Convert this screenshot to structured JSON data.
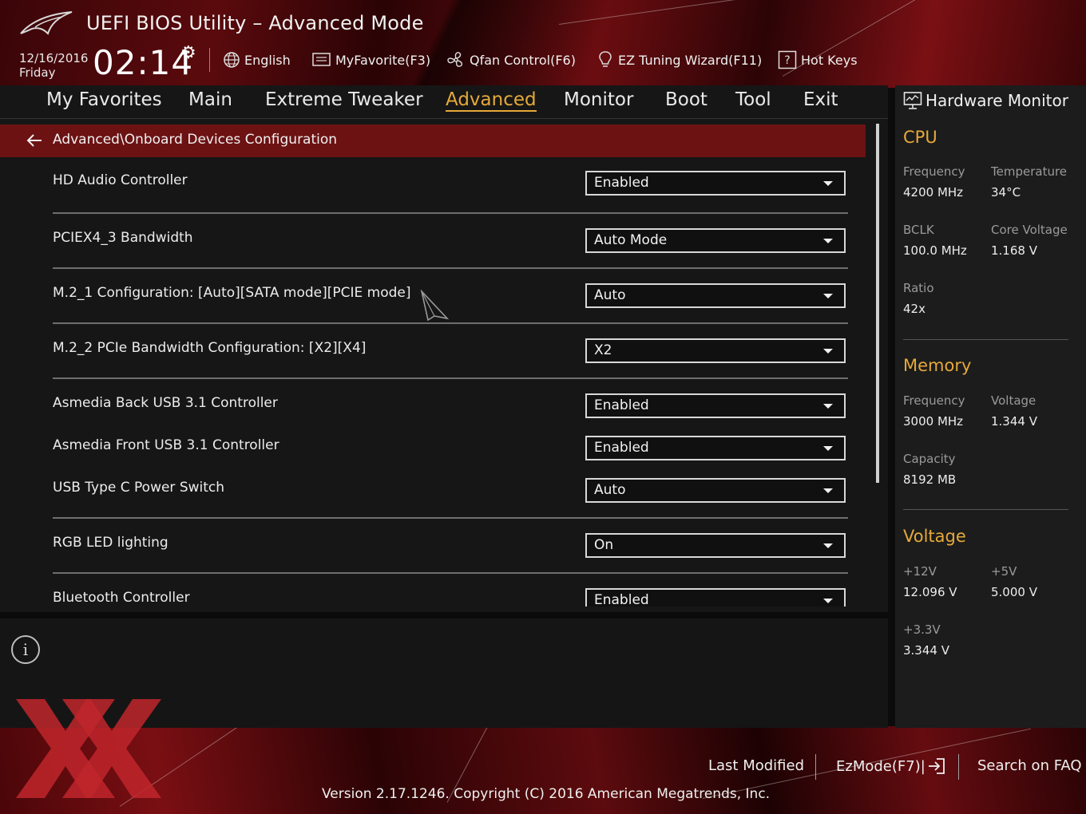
{
  "header": {
    "title": "UEFI BIOS Utility – Advanced Mode",
    "date": "12/16/2016",
    "day": "Friday",
    "time": "02:14",
    "toolbar": {
      "language": "English",
      "myfavorite": "MyFavorite(F3)",
      "qfan": "Qfan Control(F6)",
      "ez_tuning": "EZ Tuning Wizard(F11)",
      "hot_keys": "Hot Keys"
    }
  },
  "nav": {
    "tabs": [
      "My Favorites",
      "Main",
      "Extreme Tweaker",
      "Advanced",
      "Monitor",
      "Boot",
      "Tool",
      "Exit"
    ],
    "active": "Advanced"
  },
  "breadcrumb": "Advanced\\Onboard Devices Configuration",
  "settings": [
    {
      "label": "HD Audio Controller",
      "value": "Enabled"
    },
    {
      "label": "PCIEX4_3 Bandwidth",
      "value": "Auto Mode"
    },
    {
      "label": "M.2_1 Configuration: [Auto][SATA mode][PCIE mode]",
      "value": "Auto"
    },
    {
      "label": "M.2_2 PCIe Bandwidth Configuration: [X2][X4]",
      "value": "X2"
    },
    {
      "label": "Asmedia Back USB 3.1 Controller",
      "value": "Enabled"
    },
    {
      "label": "Asmedia Front USB 3.1 Controller",
      "value": "Enabled"
    },
    {
      "label": "USB Type C Power Switch",
      "value": "Auto"
    },
    {
      "label": "RGB LED lighting",
      "value": "On"
    },
    {
      "label": "Bluetooth Controller",
      "value": "Enabled"
    }
  ],
  "hardware_monitor": {
    "title": "Hardware Monitor",
    "cpu": {
      "heading": "CPU",
      "frequency_label": "Frequency",
      "frequency": "4200 MHz",
      "temperature_label": "Temperature",
      "temperature": "34°C",
      "bclk_label": "BCLK",
      "bclk": "100.0 MHz",
      "core_voltage_label": "Core Voltage",
      "core_voltage": "1.168 V",
      "ratio_label": "Ratio",
      "ratio": "42x"
    },
    "memory": {
      "heading": "Memory",
      "frequency_label": "Frequency",
      "frequency": "3000 MHz",
      "voltage_label": "Voltage",
      "voltage": "1.344 V",
      "capacity_label": "Capacity",
      "capacity": "8192 MB"
    },
    "voltage": {
      "heading": "Voltage",
      "v12_label": "+12V",
      "v12": "12.096 V",
      "v5_label": "+5V",
      "v5": "5.000 V",
      "v33_label": "+3.3V",
      "v33": "3.344 V"
    }
  },
  "footer": {
    "last_modified": "Last Modified",
    "ezmode": "EzMode(F7)|",
    "search_faq": "Search on FAQ",
    "version": "Version 2.17.1246. Copyright (C) 2016 American Megatrends, Inc."
  },
  "colors": {
    "accent": "#e6a93a",
    "breadcrumb_bg": "#6c1213",
    "panel_bg": "#161616"
  }
}
